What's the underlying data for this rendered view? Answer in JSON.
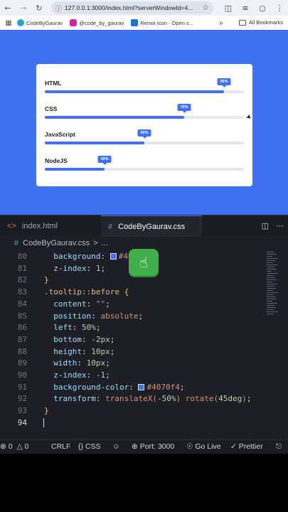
{
  "browser": {
    "url": "127.0.0.1:3000/index.html?serverWindowId=4...",
    "bookmarks": [
      {
        "label": "CodeByGaurav",
        "color": "#2a9fd8"
      },
      {
        "label": "@code_by_gaurav",
        "color": "#d6249f"
      },
      {
        "label": "Remix Icon - Open s...",
        "color": "#1a73e8"
      }
    ],
    "more": "»",
    "all_bookmarks": "All Bookmarks"
  },
  "page": {
    "skills": [
      {
        "name": "HTML",
        "percent": 90,
        "label": "90%"
      },
      {
        "name": "CSS",
        "percent": 70,
        "label": "70%"
      },
      {
        "name": "JavaScript",
        "percent": 50,
        "label": "50%"
      },
      {
        "name": "NodeJS",
        "percent": 30,
        "label": "30%"
      }
    ]
  },
  "editor": {
    "tabs": [
      {
        "label": "index.html",
        "icon": "<>"
      },
      {
        "label": "CodeByGaurav.css",
        "icon": "#"
      }
    ],
    "breadcrumb": {
      "file": "CodeByGaurav.css",
      "sep": ">",
      "rest": "..."
    },
    "lines": [
      {
        "n": "80",
        "html": "  <span class=\"prop\">background</span><span class=\"punc\">: </span><span class=\"swatch\"></span><span class=\"val\">#4070f4</span><span class=\"punc\">;</span>"
      },
      {
        "n": "81",
        "html": "  <span class=\"prop\">z-index</span><span class=\"punc\">: </span><span class=\"num\">1</span><span class=\"punc\">;</span>"
      },
      {
        "n": "82",
        "html": "<span class=\"brace\">}</span>"
      },
      {
        "n": "83",
        "html": "<span class=\"sel\">.tooltip::before</span><span class=\"punc\"> </span><span class=\"brace\">{</span>"
      },
      {
        "n": "84",
        "html": "  <span class=\"prop\">content</span><span class=\"punc\">: </span><span class=\"val\">\"\"</span><span class=\"punc\">;</span>"
      },
      {
        "n": "85",
        "html": "  <span class=\"prop\">position</span><span class=\"punc\">: </span><span class=\"val\">absolute</span><span class=\"punc\">;</span>"
      },
      {
        "n": "86",
        "html": "  <span class=\"prop\">left</span><span class=\"punc\">: </span><span class=\"num\">50%</span><span class=\"punc\">;</span>"
      },
      {
        "n": "87",
        "html": "  <span class=\"prop\">bottom</span><span class=\"punc\">: </span><span class=\"num\">-2px</span><span class=\"punc\">;</span>"
      },
      {
        "n": "88",
        "html": "  <span class=\"prop\">height</span><span class=\"punc\">: </span><span class=\"num\">10px</span><span class=\"punc\">;</span>"
      },
      {
        "n": "89",
        "html": "  <span class=\"prop\">width</span><span class=\"punc\">: </span><span class=\"num\">10px</span><span class=\"punc\">;</span>"
      },
      {
        "n": "90",
        "html": "  <span class=\"prop\">z-index</span><span class=\"punc\">: </span><span class=\"num\">-1</span><span class=\"punc\">;</span>"
      },
      {
        "n": "91",
        "html": "  <span class=\"prop\">background-color</span><span class=\"punc\">: </span><span class=\"swatch\"></span><span class=\"val\">#4070f4</span><span class=\"punc\">;</span>"
      },
      {
        "n": "92",
        "html": "  <span class=\"prop\">transform</span><span class=\"punc\">: </span><span class=\"val\">translateX(</span><span class=\"num\">-50%</span><span class=\"val\">) rotate(</span><span class=\"num\">45deg</span><span class=\"val\">)</span><span class=\"punc\">;</span>"
      },
      {
        "n": "93",
        "html": "<span class=\"brace\">}</span>"
      },
      {
        "n": "94",
        "html": ""
      }
    ]
  },
  "status": {
    "problems": "0",
    "warnings": "0",
    "eol": "CRLF",
    "lang": "CSS",
    "port": "Port: 3000",
    "golive": "Go Live",
    "prettier": "Prettier"
  },
  "colors": {
    "accent": "#4070f4"
  }
}
